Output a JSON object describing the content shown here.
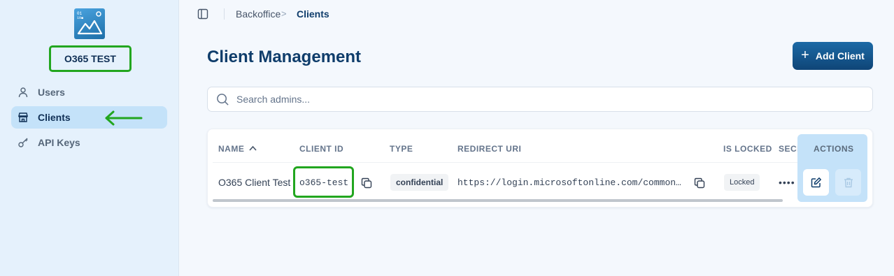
{
  "sidebar": {
    "org_name": "O365 TEST",
    "items": [
      {
        "label": "Users",
        "icon": "user-icon"
      },
      {
        "label": "Clients",
        "icon": "store-icon",
        "active": true
      },
      {
        "label": "API Keys",
        "icon": "key-icon"
      }
    ]
  },
  "breadcrumb": {
    "root": "Backoffice",
    "separator": ">",
    "current": "Clients"
  },
  "page": {
    "title": "Client Management",
    "add_button": "Add Client",
    "add_icon": "+"
  },
  "search": {
    "placeholder": "Search admins...",
    "value": ""
  },
  "table": {
    "columns": [
      "NAME",
      "CLIENT ID",
      "TYPE",
      "REDIRECT URI",
      "IS LOCKED",
      "SECR",
      "ACTIONS"
    ],
    "sort": {
      "column": "NAME",
      "direction": "ascending"
    },
    "rows": [
      {
        "name": "O365 Client Test",
        "client_id": "o365-test",
        "type": "confidential",
        "redirect_uri": "https://login.microsoftonline.com/common…",
        "is_locked": "Locked",
        "secret": "••••"
      }
    ]
  },
  "colors": {
    "accent": "#0f3d6b",
    "active_bg": "#c4e2f9",
    "highlight": "#22a61f",
    "sidebar_bg": "#e5f1fc"
  }
}
